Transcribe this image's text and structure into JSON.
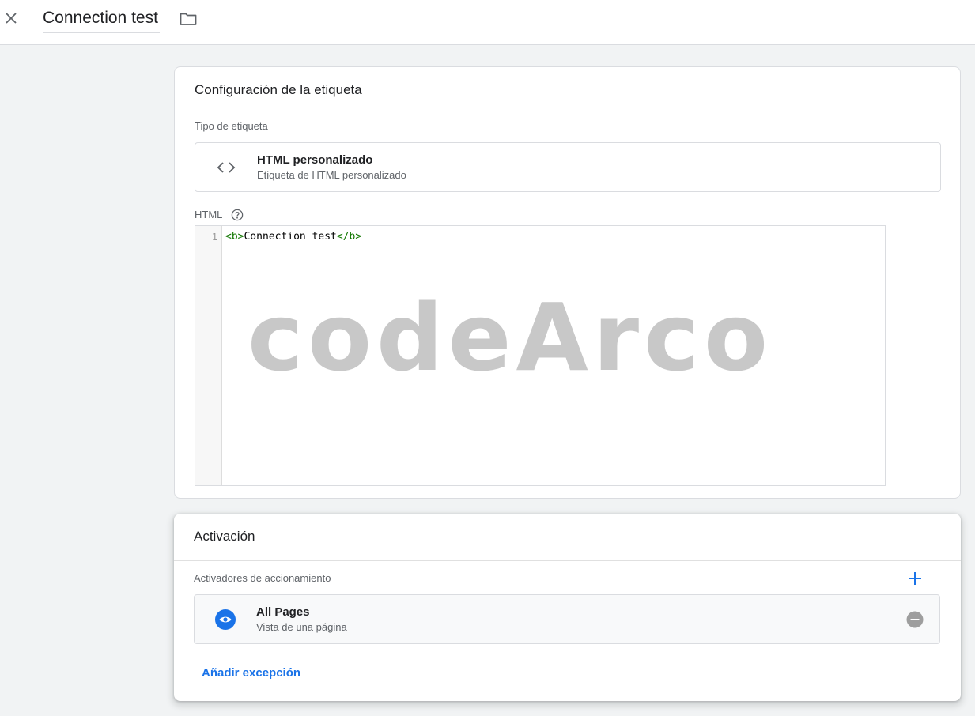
{
  "header": {
    "title": "Connection test"
  },
  "config_card": {
    "title": "Configuración de la etiqueta",
    "tag_type_label": "Tipo de etiqueta",
    "tag_type": {
      "name": "HTML personalizado",
      "description": "Etiqueta de HTML personalizado",
      "icon": "code-icon"
    },
    "html_label": "HTML",
    "editor": {
      "line_number": "1",
      "open_tag": "<b>",
      "content": "Connection test",
      "close_tag": "</b>"
    },
    "watermark": "codeArco"
  },
  "trigger_card": {
    "title": "Activación",
    "triggers_label": "Activadores de accionamiento",
    "trigger": {
      "name": "All Pages",
      "description": "Vista de una página",
      "icon": "eye-icon"
    },
    "add_exception_label": "Añadir excepción"
  },
  "colors": {
    "accent": "#1a73e8",
    "background": "#f1f3f4",
    "code_tag": "#117700",
    "remove_icon": "#9e9e9e"
  }
}
